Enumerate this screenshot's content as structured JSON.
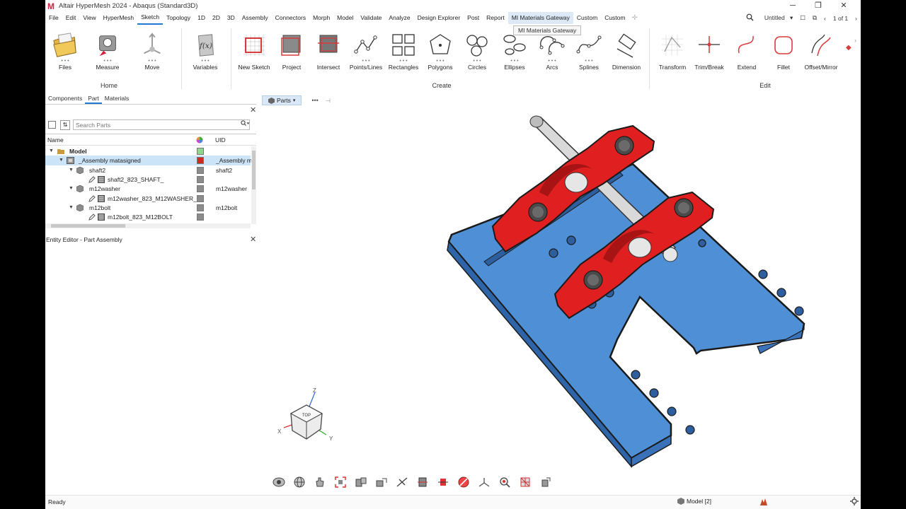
{
  "window": {
    "title": "Altair HyperMesh 2024 - Abaqus (Standard3D)",
    "controls": [
      "─",
      "❐",
      "✕"
    ]
  },
  "menu": {
    "items": [
      "File",
      "Edit",
      "View",
      "HyperMesh",
      "Sketch",
      "Topology",
      "1D",
      "2D",
      "3D",
      "Assembly",
      "Connectors",
      "Morph",
      "Model",
      "Validate",
      "Analyze",
      "Design Explorer",
      "Post",
      "Report",
      "MI Materials Gateway",
      "Custom",
      "Custom"
    ],
    "active": "Sketch",
    "hovered": "MI Materials Gateway",
    "tooltip": "MI Materials Gateway",
    "session": "Untitled",
    "page_indicator": "1 of 1"
  },
  "ribbon": {
    "groups": [
      {
        "name": "Home",
        "tools": [
          "Files",
          "Measure",
          "Move"
        ]
      },
      {
        "name": "",
        "tools": [
          "Variables"
        ]
      },
      {
        "name": "Create",
        "tools": [
          "New Sketch",
          "Project",
          "Intersect",
          "Points/Lines",
          "Rectangles",
          "Polygons",
          "Circles",
          "Ellipses",
          "Arcs",
          "Splines",
          "Dimension"
        ]
      },
      {
        "name": "Edit",
        "tools": [
          "Transform",
          "Trim/Break",
          "Extend",
          "Fillet",
          "Offset/Mirror"
        ]
      }
    ],
    "tool_dots": "• • •"
  },
  "browser": {
    "tabs": [
      "Components",
      "Part",
      "Materials"
    ],
    "active_tab": "Part",
    "search_placeholder": "Search Parts",
    "columns": [
      "Name",
      "UID"
    ],
    "rows": [
      {
        "name": "Model",
        "uid": "",
        "color": "#8ed88e"
      },
      {
        "name": "_Assembly matasigned",
        "uid": "_Assembly ma",
        "color": "#d2281e"
      },
      {
        "name": "shaft2",
        "uid": "shaft2",
        "color": "#8c8c8c"
      },
      {
        "name": "shaft2_823_SHAFT_",
        "uid": "",
        "color": "#8c8c8c"
      },
      {
        "name": "m12washer",
        "uid": "m12washer",
        "color": "#8c8c8c"
      },
      {
        "name": "m12washer_823_M12WASHER_",
        "uid": "",
        "color": "#8c8c8c"
      },
      {
        "name": "m12bolt",
        "uid": "m12bolt",
        "color": "#8c8c8c"
      },
      {
        "name": "m12bolt_823_M12BOLT",
        "uid": "",
        "color": "#8c8c8c"
      }
    ]
  },
  "entity_editor": {
    "title": "Entity Editor - Part Assembly"
  },
  "viewport": {
    "parts_button": "Parts",
    "more": "•••",
    "axes": {
      "x": "X",
      "y": "Y",
      "z": "Z"
    },
    "cube_face": "TOP"
  },
  "status": {
    "text": "Ready",
    "model": "Model [2]"
  },
  "colors": {
    "accent": "#1f7ad1",
    "part_blue": "#4e8fd6",
    "part_red": "#d2281e"
  }
}
